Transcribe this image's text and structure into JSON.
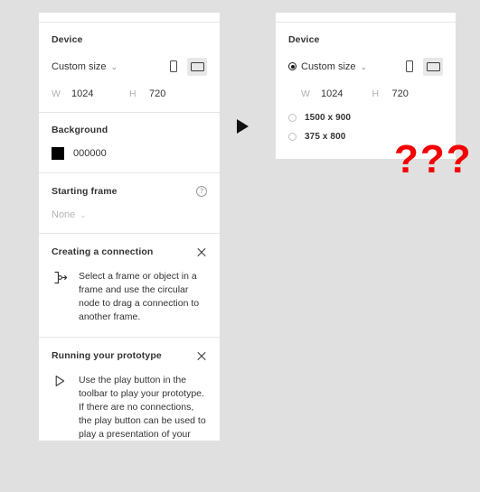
{
  "canvas": {
    "background_color": "#e0e0e0",
    "accent_red": "#f40000",
    "question_marks": "???"
  },
  "left_panel": {
    "clipped_row": {
      "left": "",
      "mid": "",
      "right": ""
    },
    "device": {
      "title": "Device",
      "selected_size_label": "Custom size",
      "chevron": "⌄",
      "orientation": {
        "portrait_icon": "portrait-icon",
        "landscape_icon": "landscape-icon",
        "active": "landscape"
      },
      "width_label": "W",
      "width_value": "1024",
      "height_label": "H",
      "height_value": "720"
    },
    "background": {
      "title": "Background",
      "swatch_color": "#000000",
      "hex_value": "000000"
    },
    "starting_frame": {
      "title": "Starting frame",
      "help_icon": "help-circle-icon",
      "help_glyph": "?",
      "value": "None",
      "chevron": "⌄"
    },
    "tips": [
      {
        "title": "Creating a connection",
        "icon": "connection-node-icon",
        "close_icon": "close-icon",
        "body": "Select a frame or object in a frame and use the circular node to drag a connection to another frame."
      },
      {
        "title": "Running your prototype",
        "icon": "play-icon",
        "close_icon": "close-icon",
        "body": "Use the play button in the toolbar to play your prototype. If there are no connections, the play button can be used to play a presentation of your frames."
      }
    ]
  },
  "right_panel": {
    "clipped_row": {
      "left": "",
      "mid": "",
      "right": ""
    },
    "device": {
      "title": "Device",
      "selected_size_label": "Custom size",
      "chevron": "⌄",
      "orientation": {
        "portrait_icon": "portrait-icon",
        "landscape_icon": "landscape-icon",
        "active": "landscape"
      },
      "width_label": "W",
      "width_value": "1024",
      "height_label": "H",
      "height_value": "720"
    },
    "size_options": [
      {
        "label": "1500 x 900",
        "selected": false
      },
      {
        "label": "375 x 800",
        "selected": false
      }
    ]
  }
}
